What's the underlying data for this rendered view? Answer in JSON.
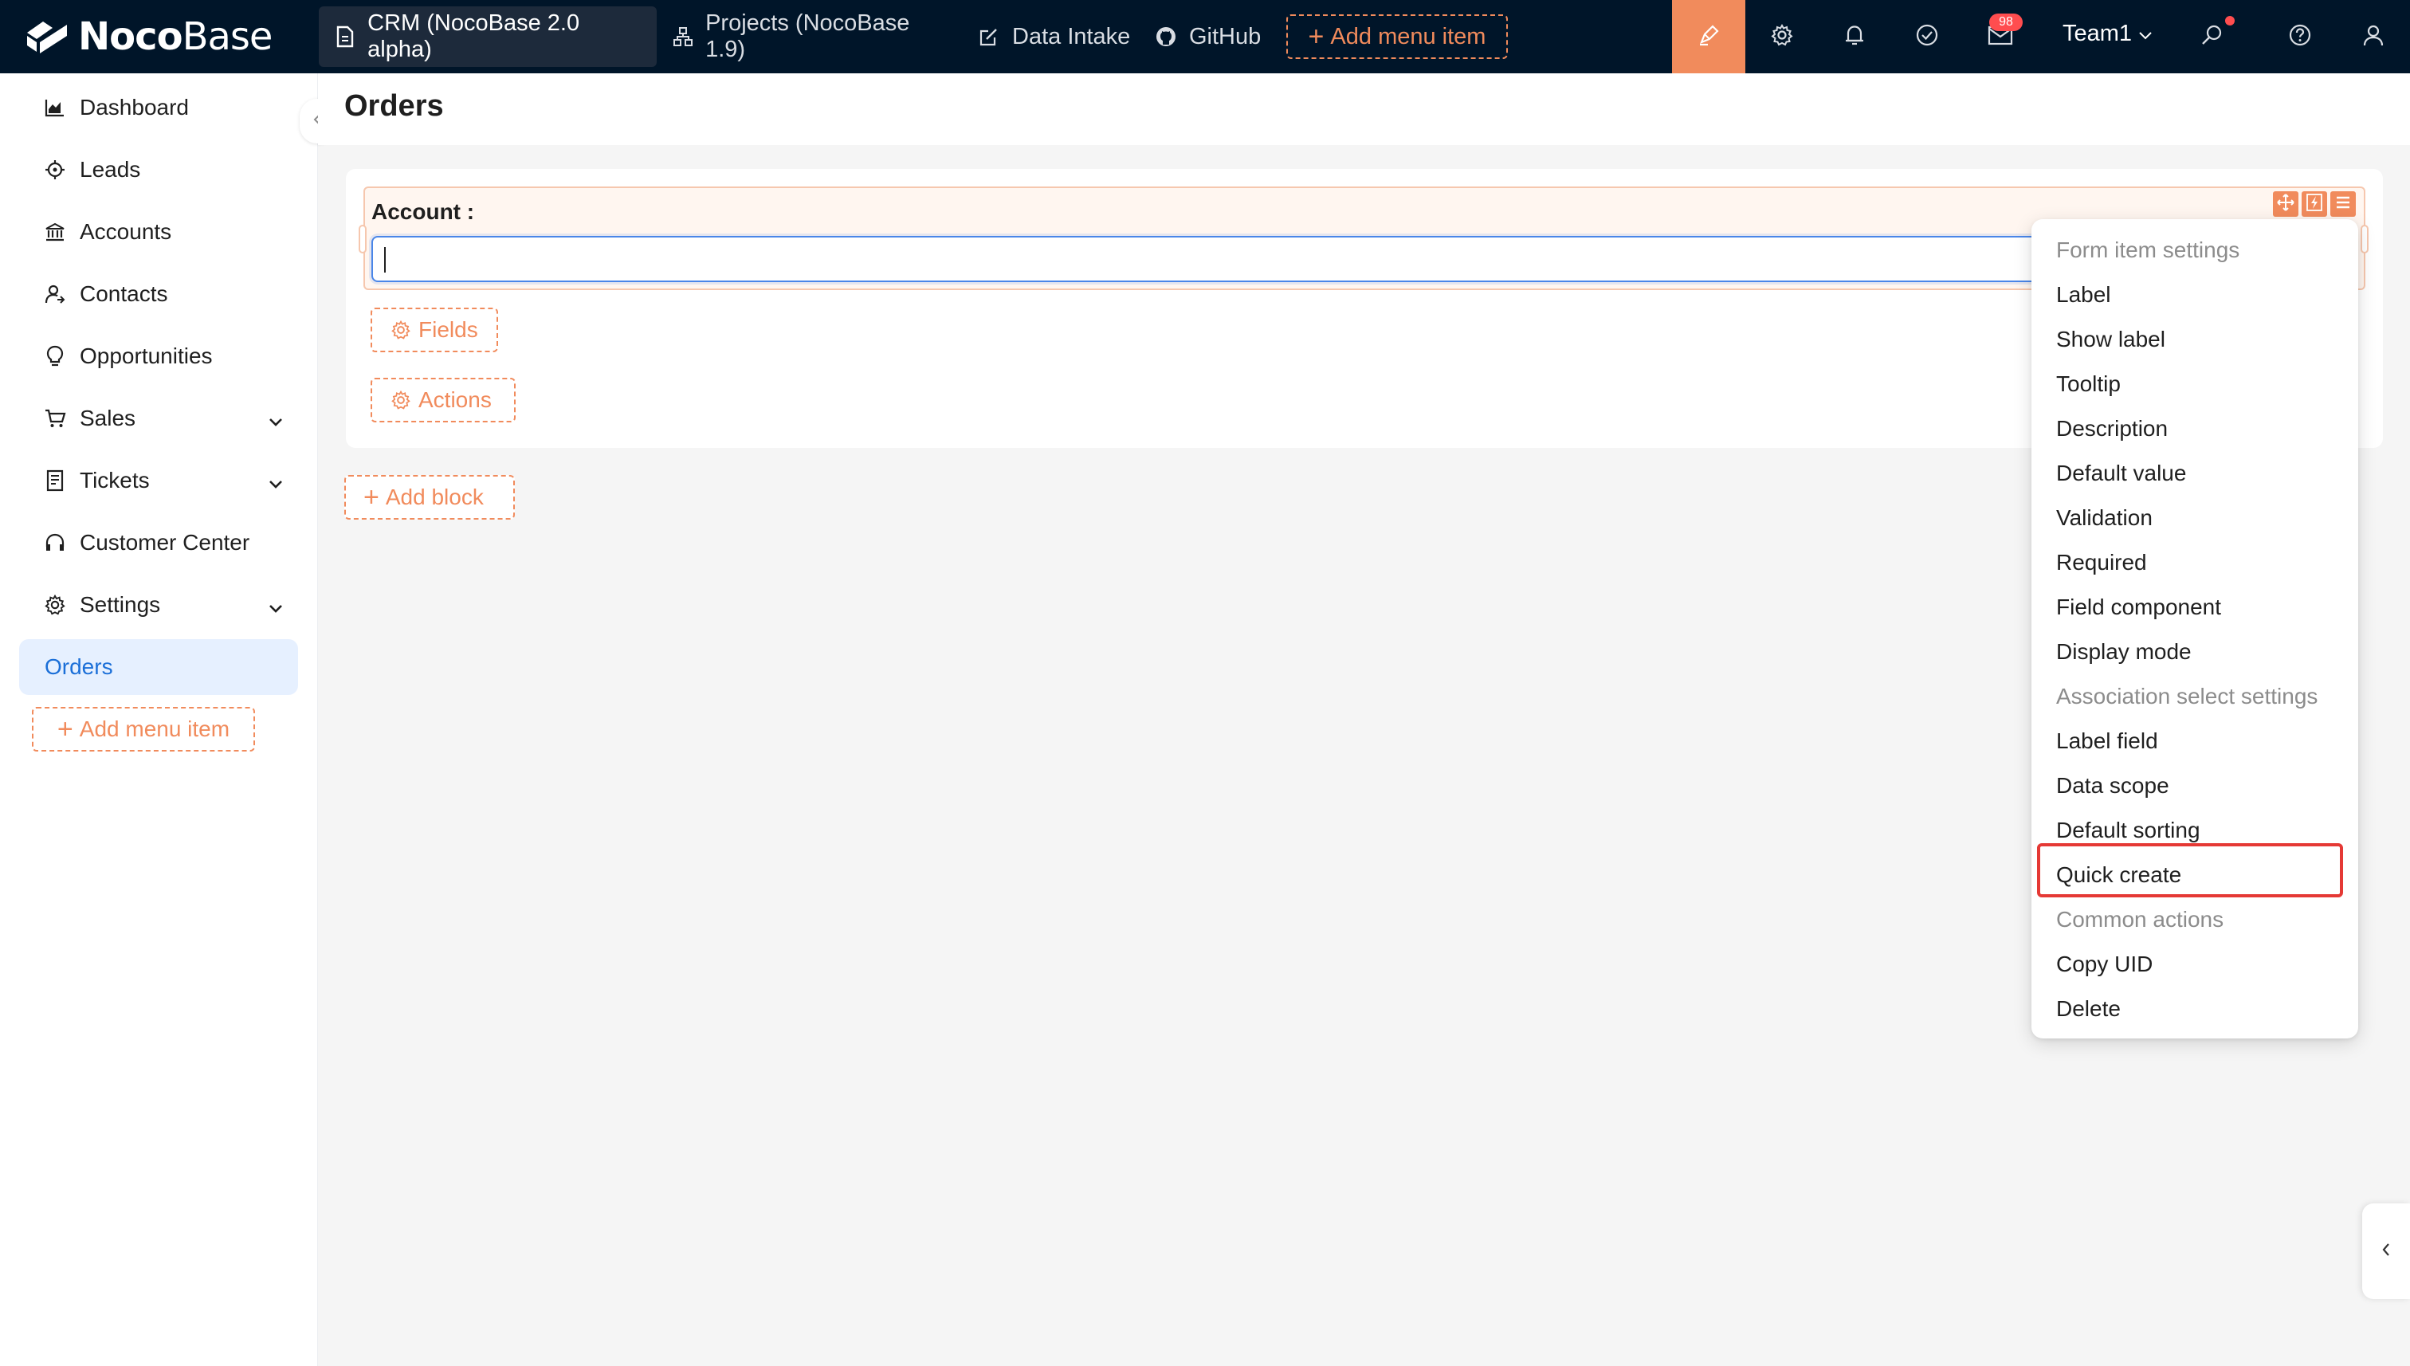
{
  "brand": {
    "name_bold": "Noco",
    "name_light": "Base"
  },
  "topnav": {
    "items": [
      {
        "label": "CRM (NocoBase 2.0 alpha)",
        "icon": "file-icon",
        "active": true
      },
      {
        "label": "Projects (NocoBase 1.9)",
        "icon": "org-chart-icon",
        "active": false
      },
      {
        "label": "Data Intake",
        "icon": "edit-icon",
        "active": false
      },
      {
        "label": "GitHub",
        "icon": "github-icon",
        "active": false
      }
    ],
    "add_menu_item": "Add menu item",
    "mail_badge": "98",
    "team": "Team1",
    "accent_color": "#f18b5c"
  },
  "sidebar": {
    "items": [
      {
        "label": "Dashboard",
        "icon": "area-chart-icon"
      },
      {
        "label": "Leads",
        "icon": "aim-icon"
      },
      {
        "label": "Accounts",
        "icon": "bank-icon"
      },
      {
        "label": "Contacts",
        "icon": "user-switch-icon"
      },
      {
        "label": "Opportunities",
        "icon": "bulb-icon"
      },
      {
        "label": "Sales",
        "icon": "cart-icon",
        "expandable": true
      },
      {
        "label": "Tickets",
        "icon": "ticket-icon",
        "expandable": true
      },
      {
        "label": "Customer Center",
        "icon": "headset-icon"
      },
      {
        "label": "Settings",
        "icon": "gear-icon",
        "expandable": true
      },
      {
        "label": "Orders",
        "active": true
      }
    ],
    "add_menu_item": "Add menu item"
  },
  "page": {
    "title": "Orders",
    "form": {
      "field_label": "Account :",
      "fields_button": "Fields",
      "actions_button": "Actions"
    },
    "add_block": "Add block"
  },
  "dropdown": {
    "items": [
      {
        "label": "Form item settings",
        "group": true
      },
      {
        "label": "Label"
      },
      {
        "label": "Show label"
      },
      {
        "label": "Tooltip"
      },
      {
        "label": "Description"
      },
      {
        "label": "Default value"
      },
      {
        "label": "Validation"
      },
      {
        "label": "Required"
      },
      {
        "label": "Field component"
      },
      {
        "label": "Display mode"
      },
      {
        "label": "Association select settings",
        "group": true
      },
      {
        "label": "Label field"
      },
      {
        "label": "Data scope"
      },
      {
        "label": "Default sorting"
      },
      {
        "label": "Quick create",
        "highlighted": true
      },
      {
        "label": "Common actions",
        "group": true
      },
      {
        "label": "Copy UID"
      },
      {
        "label": "Delete"
      }
    ]
  }
}
